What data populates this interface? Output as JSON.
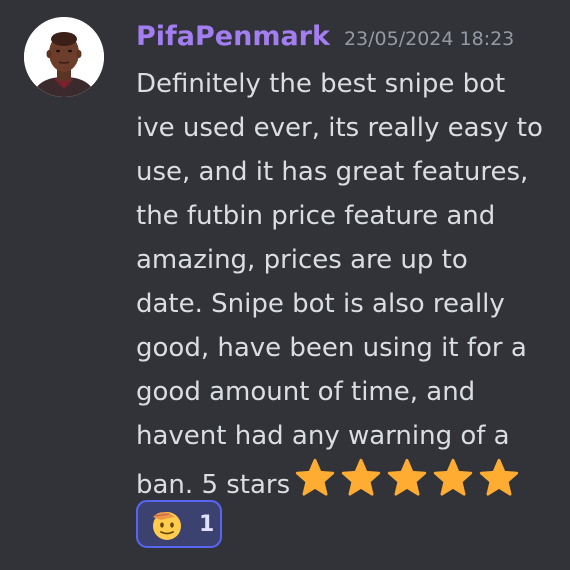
{
  "message": {
    "author": "PifaPenmark",
    "timestamp": "23/05/2024 18:23",
    "lines": [
      "Definitely the best snipe bot",
      "ive used ever, its really easy to",
      "use, and it has great features,",
      "the futbin price feature and",
      "amazing, prices are up to",
      "date. Snipe bot is also really",
      "good, have been using it for a",
      "good amount of time, and",
      "havent had any warning of a",
      "ban. 5 stars"
    ],
    "stars_emoji_count": 5,
    "emoji_icons": [
      "star-icon",
      "star-icon",
      "star-icon",
      "star-icon",
      "star-icon"
    ]
  },
  "reaction": {
    "emoji_icon": "saluting-face-icon",
    "count": "1"
  },
  "colors": {
    "background": "#313338",
    "username": "#a27ef0",
    "timestamp": "#949ba4",
    "text": "#dbdee1",
    "star": "#ffac33",
    "reaction_border": "#5865f2",
    "reaction_bg": "#3c4270"
  }
}
